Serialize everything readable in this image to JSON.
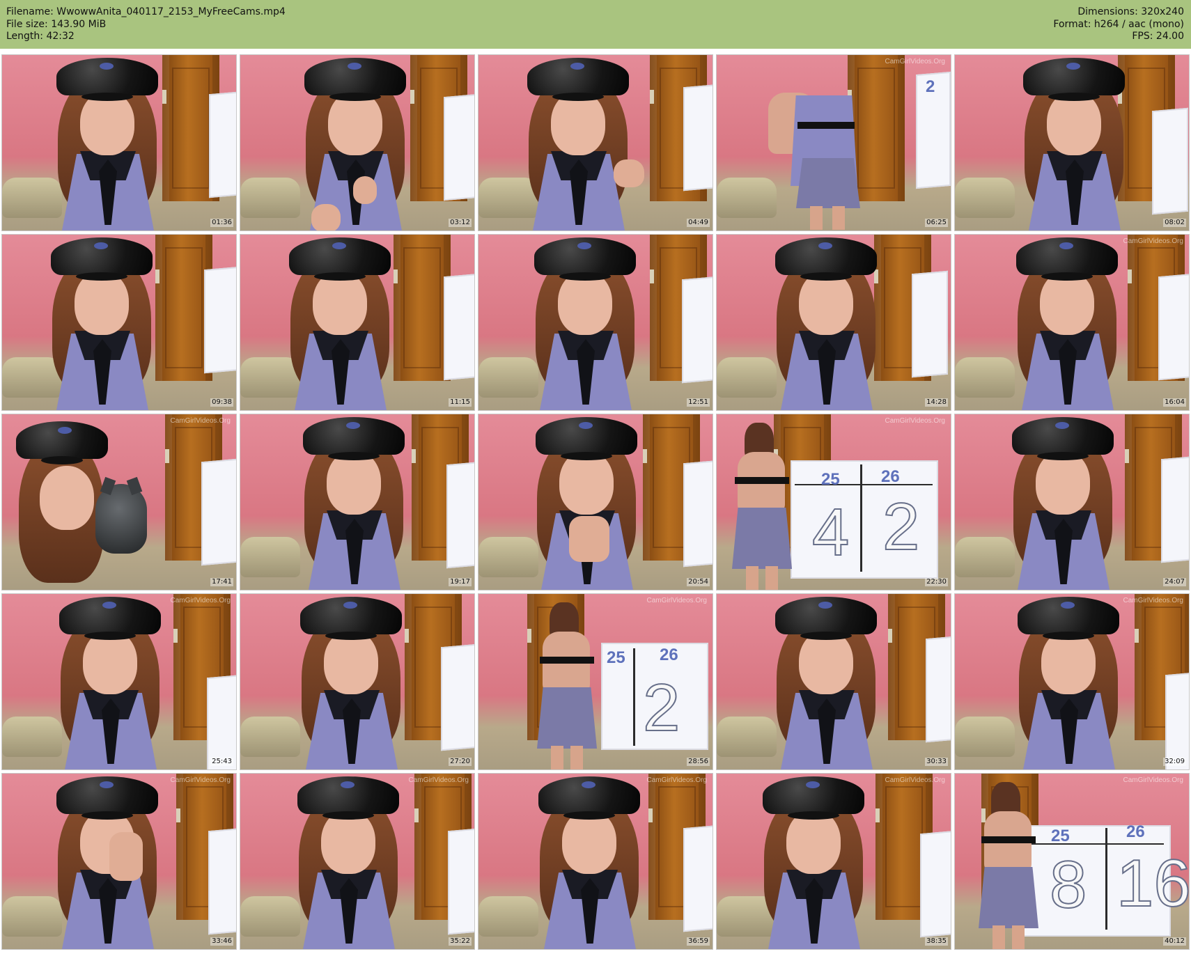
{
  "header": {
    "left": [
      "Filename: WwowwAnita_040117_2153_MyFreeCams.mp4",
      "File size: 143.90 MiB",
      "Length: 42:32"
    ],
    "right": [
      "Dimensions: 320x240",
      "Format: h264 / aac (mono)",
      "FPS: 24.00"
    ]
  },
  "thumbs": [
    {
      "time": "01:36"
    },
    {
      "time": "03:12"
    },
    {
      "time": "04:49"
    },
    {
      "time": "06:25",
      "watermark": "CamGirlVideos.Org",
      "board_text": "2"
    },
    {
      "time": "08:02"
    },
    {
      "time": "09:38"
    },
    {
      "time": "11:15"
    },
    {
      "time": "12:51"
    },
    {
      "time": "14:28"
    },
    {
      "time": "16:04",
      "watermark": "CamGirlVideos.Org"
    },
    {
      "time": "17:41",
      "watermark": "CamGirlVideos.Org"
    },
    {
      "time": "19:17"
    },
    {
      "time": "20:54"
    },
    {
      "time": "22:30",
      "watermark": "CamGirlVideos.Org",
      "left_number": "25",
      "right_number": "26",
      "left_big": "4",
      "right_big": "2"
    },
    {
      "time": "24:07"
    },
    {
      "time": "25:43",
      "watermark": "CamGirlVideos.Org"
    },
    {
      "time": "27:20"
    },
    {
      "time": "28:56",
      "watermark": "CamGirlVideos.Org",
      "left_number": "25",
      "right_number": "26",
      "right_big": "2"
    },
    {
      "time": "30:33"
    },
    {
      "time": "32:09",
      "watermark": "CamGirlVideos.Org"
    },
    {
      "time": "33:46",
      "watermark": "CamGirlVideos.Org"
    },
    {
      "time": "35:22",
      "watermark": "CamGirlVideos.Org"
    },
    {
      "time": "36:59",
      "watermark": "CamGirlVideos.Org"
    },
    {
      "time": "38:35",
      "watermark": "CamGirlVideos.Org"
    },
    {
      "time": "40:12",
      "watermark": "CamGirlVideos.Org",
      "left_number": "25",
      "right_number": "26",
      "left_big": "8",
      "right_big": "16"
    }
  ]
}
